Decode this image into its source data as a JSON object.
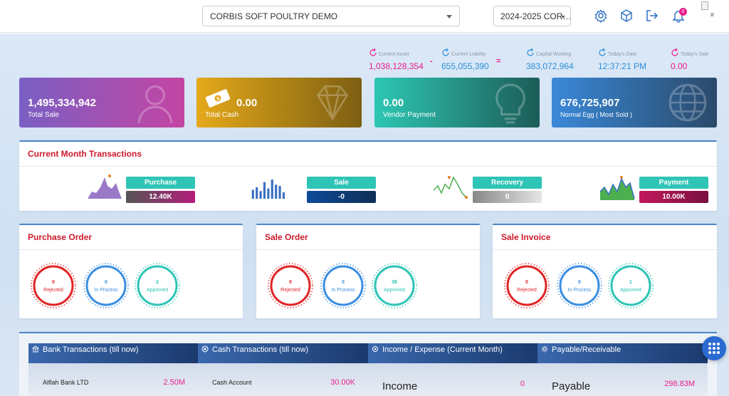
{
  "header": {
    "company": "CORBIS SOFT POULTRY DEMO",
    "year": "2024-2025 COR…",
    "icons": [
      "gear-icon",
      "box-icon",
      "logout-icon",
      "bell-icon"
    ],
    "notification_count": "0",
    "misc_text": "#"
  },
  "summary": [
    {
      "label": "Current Asset",
      "value": "1,038,128,354",
      "color": "#e91e8c"
    },
    {
      "label": "Current Liability",
      "value": "655,055,390",
      "color": "#2a8fd8"
    },
    {
      "label": "Capital Working",
      "value": "383,072,964",
      "color": "#2a8fd8"
    },
    {
      "label": "Today's Date",
      "value": "12:37:21 PM",
      "color": "#2a8fd8"
    },
    {
      "label": "Today's Sale",
      "value": "0.00",
      "color": "#e91e8c"
    }
  ],
  "operators": {
    "minus": "-",
    "equals": "="
  },
  "kpis": [
    {
      "value": "1,495,334,942",
      "label": "Total Sale",
      "icon": "user-icon"
    },
    {
      "value": "0.00",
      "label": "Total Cash",
      "icon": "diamond-icon"
    },
    {
      "value": "0.00",
      "label": "Vendor Payment",
      "icon": "lightbulb-icon"
    },
    {
      "value": "676,725,907",
      "label": "Normal Egg ( Most Sold )",
      "icon": "globe-icon"
    }
  ],
  "transactions": {
    "title": "Current Month Transactions",
    "items": [
      {
        "name": "Purchase",
        "value": "12.40K"
      },
      {
        "name": "Sale",
        "value": "-0"
      },
      {
        "name": "Recovery",
        "value": "0"
      },
      {
        "name": "Payment",
        "value": "10.00K"
      }
    ]
  },
  "orders": [
    {
      "title": "Purchase Order",
      "gauges": [
        {
          "count": "0",
          "label": "Rejected"
        },
        {
          "count": "0",
          "label": "In Process"
        },
        {
          "count": "2",
          "label": "Approved"
        }
      ]
    },
    {
      "title": "Sale Order",
      "gauges": [
        {
          "count": "0",
          "label": "Rejected"
        },
        {
          "count": "0",
          "label": "In Process"
        },
        {
          "count": "38",
          "label": "Approved"
        }
      ]
    },
    {
      "title": "Sale Invoice",
      "gauges": [
        {
          "count": "0",
          "label": "Rejected"
        },
        {
          "count": "0",
          "label": "In Process"
        },
        {
          "count": "1",
          "label": "Approved"
        }
      ]
    }
  ],
  "bottom": [
    {
      "title": "Bank Transactions (till now)",
      "name": "Alflah Bank LTD",
      "amount": "2.50M"
    },
    {
      "title": "Cash Transactions (till now)",
      "name": "Cash Account",
      "amount": "30.00K"
    },
    {
      "title": "Income / Expense (Current Month)",
      "name": "Income",
      "amount": "0"
    },
    {
      "title": "Payable/Receivable",
      "name": "Payable",
      "amount": "298.83M"
    }
  ]
}
